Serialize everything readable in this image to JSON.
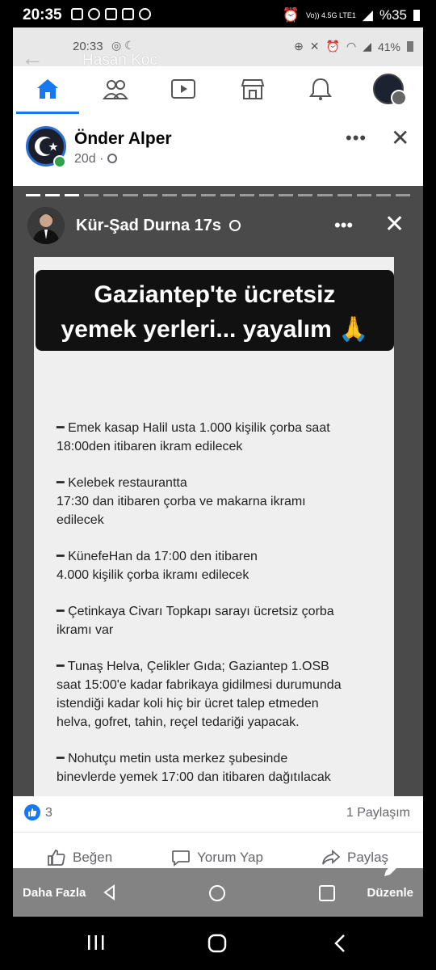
{
  "outer_status": {
    "time": "20:35",
    "network": "Vo)) 4.5G LTE1",
    "battery": "%35"
  },
  "inner_status": {
    "time": "20:33",
    "battery": "41%",
    "viewer_name": "Hasan Koç"
  },
  "tabs": [
    {
      "name": "home",
      "icon": "home-icon"
    },
    {
      "name": "friends",
      "icon": "friends-icon"
    },
    {
      "name": "watch",
      "icon": "video-icon"
    },
    {
      "name": "marketplace",
      "icon": "store-icon"
    },
    {
      "name": "notifications",
      "icon": "bell-icon"
    },
    {
      "name": "menu",
      "icon": "profile-menu-icon"
    }
  ],
  "post": {
    "author": "Önder Alper",
    "meta": "20d ·",
    "more": "•••",
    "close": "✕"
  },
  "story": {
    "author": "Kür-Şad Durna 17s",
    "headline_line1": "Gaziantep'te ücretsiz",
    "headline_line2": "yemek yerleri... yayalım 🙏",
    "items": [
      "━ Emek kasap Halil usta 1.000 kişilik çorba saat\n18:00den itibaren ikram edilecek",
      "━ Kelebek restaurantta\n17:30 dan itibaren çorba ve makarna ikramı\nedilecek",
      "━ KünefeHan da 17:00 den itibaren\n4.000 kişilik çorba ikramı edilecek",
      "━ Çetinkaya Civarı Topkapı sarayı ücretsiz çorba\nikramı var",
      "━ Tunaş Helva, Çelikler Gıda; Gaziantep 1.OSB\nsaat 15:00'e kadar fabrikaya gidilmesi durumunda\nistendiği kadar koli hiç bir ücret talep etmeden\nhelva, gofret, tahin, reçel tedariği yapacak.",
      "━ Nohutçu metin usta merkez şubesinde\nbinevlerde yemek 17:00 dan itibaren dağıtılacak"
    ]
  },
  "reactions": {
    "like_count": "3",
    "shares": "1 Paylaşım"
  },
  "actions": {
    "like": "Beğen",
    "comment": "Yorum Yap",
    "share": "Paylaş"
  },
  "inner_nav": {
    "more": "Daha Fazla",
    "edit": "Düzenle"
  },
  "colors": {
    "accent": "#1877f2",
    "online": "#31a24c"
  }
}
